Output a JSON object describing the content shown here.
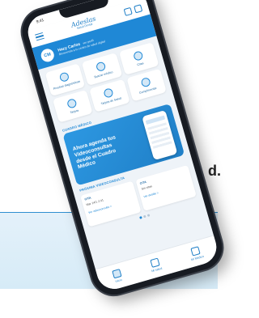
{
  "background": {
    "trailing_text": "d.",
    "band_color": "#e4f1fa",
    "line_color": "#2f8fd0"
  },
  "status": {
    "time": "9:41",
    "signal": "▮▮▮"
  },
  "header": {
    "brand_line1": "Adeslas",
    "brand_line2": "Salud Dental"
  },
  "user": {
    "initials": "CM",
    "name": "Hazy Carlos",
    "name_tag": "ver perfil",
    "subtitle": "Bienvenido a tu centro de salud digital"
  },
  "quick_access": [
    {
      "label": "Pruebas diagnósticas",
      "icon": "medical-test-icon"
    },
    {
      "label": "Buscar médico",
      "icon": "doctor-search-icon"
    },
    {
      "label": "Citas",
      "icon": "calendar-icon"
    },
    {
      "label": "Tarjeta",
      "icon": "card-icon"
    },
    {
      "label": "Tarjeta de Salud",
      "icon": "health-card-icon"
    },
    {
      "label": "Cumplimentar",
      "icon": "form-icon"
    }
  ],
  "promo": {
    "section": "CUADRO MÉDICO",
    "headline": "Ahora agenda tus Videoconsultas desde el Cuadro Médico"
  },
  "appointments": {
    "section": "PRÓXIMA VIDEOCONSULTA",
    "cards": [
      {
        "title": "CITA",
        "date": "Mar 14/1 2:41",
        "link": "Ver videoconsulta >"
      },
      {
        "title": "CITA",
        "date": "Sin citas",
        "link": "Ver detalle >"
      }
    ]
  },
  "tabs": [
    {
      "label": "Inicio",
      "icon": "home-icon"
    },
    {
      "label": "Mi salud",
      "icon": "shield-icon"
    },
    {
      "label": "Mi Médico",
      "icon": "doctor-icon"
    }
  ],
  "colors": {
    "accent": "#1f88d6",
    "frame": "#171b22"
  }
}
